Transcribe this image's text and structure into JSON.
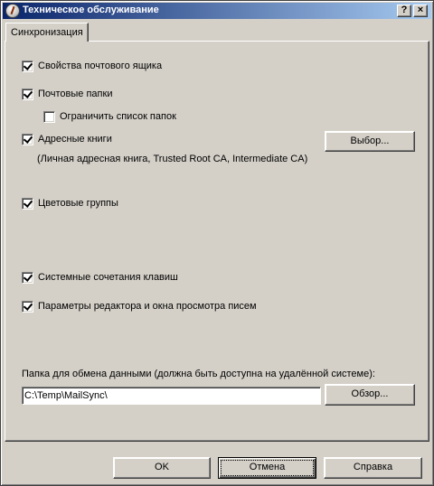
{
  "window": {
    "title": "Техническое обслуживание",
    "help_button": "?",
    "close_button": "×"
  },
  "tabs": [
    {
      "label": "Синхронизация",
      "selected": true
    }
  ],
  "sync": {
    "mailbox_properties": {
      "label": "Свойства почтового ящика",
      "checked": true
    },
    "mail_folders": {
      "label": "Почтовые папки",
      "checked": true
    },
    "limit_folder_list": {
      "label": "Ограничить список папок",
      "checked": false
    },
    "address_books": {
      "label": "Адресные книги",
      "checked": true
    },
    "address_books_select_button": "Выбор...",
    "address_books_list": "(Личная адресная книга, Trusted Root CA, Intermediate CA)",
    "color_groups": {
      "label": "Цветовые группы",
      "checked": true
    },
    "keyboard_shortcuts": {
      "label": "Системные сочетания клавиш",
      "checked": true
    },
    "editor_view_params": {
      "label": "Параметры редактора и окна просмотра писем",
      "checked": true
    },
    "exchange_folder_label": "Папка для обмена данными (должна быть доступна на удалённой системе):",
    "exchange_folder_value": "C:\\Temp\\MailSync\\",
    "browse_button": "Обзор..."
  },
  "footer": {
    "ok_label": "OK",
    "cancel_label": "Отмена",
    "help_label": "Справка"
  }
}
